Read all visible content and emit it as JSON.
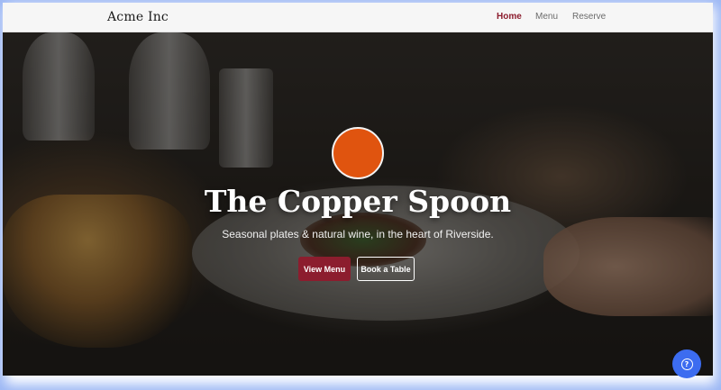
{
  "navbar": {
    "brand": "Acme Inc",
    "links": [
      {
        "label": "Home",
        "active": true
      },
      {
        "label": "Menu",
        "active": false
      },
      {
        "label": "Reserve",
        "active": false
      }
    ]
  },
  "hero": {
    "title": "The Copper Spoon",
    "subtitle": "Seasonal plates & natural wine, in the heart of Riverside.",
    "primary_button": "View Menu",
    "secondary_button": "Book a Table",
    "logo_color": "#e0540f"
  },
  "help_button": {
    "icon": "question-circle-icon",
    "color": "#3c6cf0",
    "glyph": "?"
  },
  "colors": {
    "accent": "#8c1d2e",
    "navbar_bg": "#f6f6f6"
  }
}
